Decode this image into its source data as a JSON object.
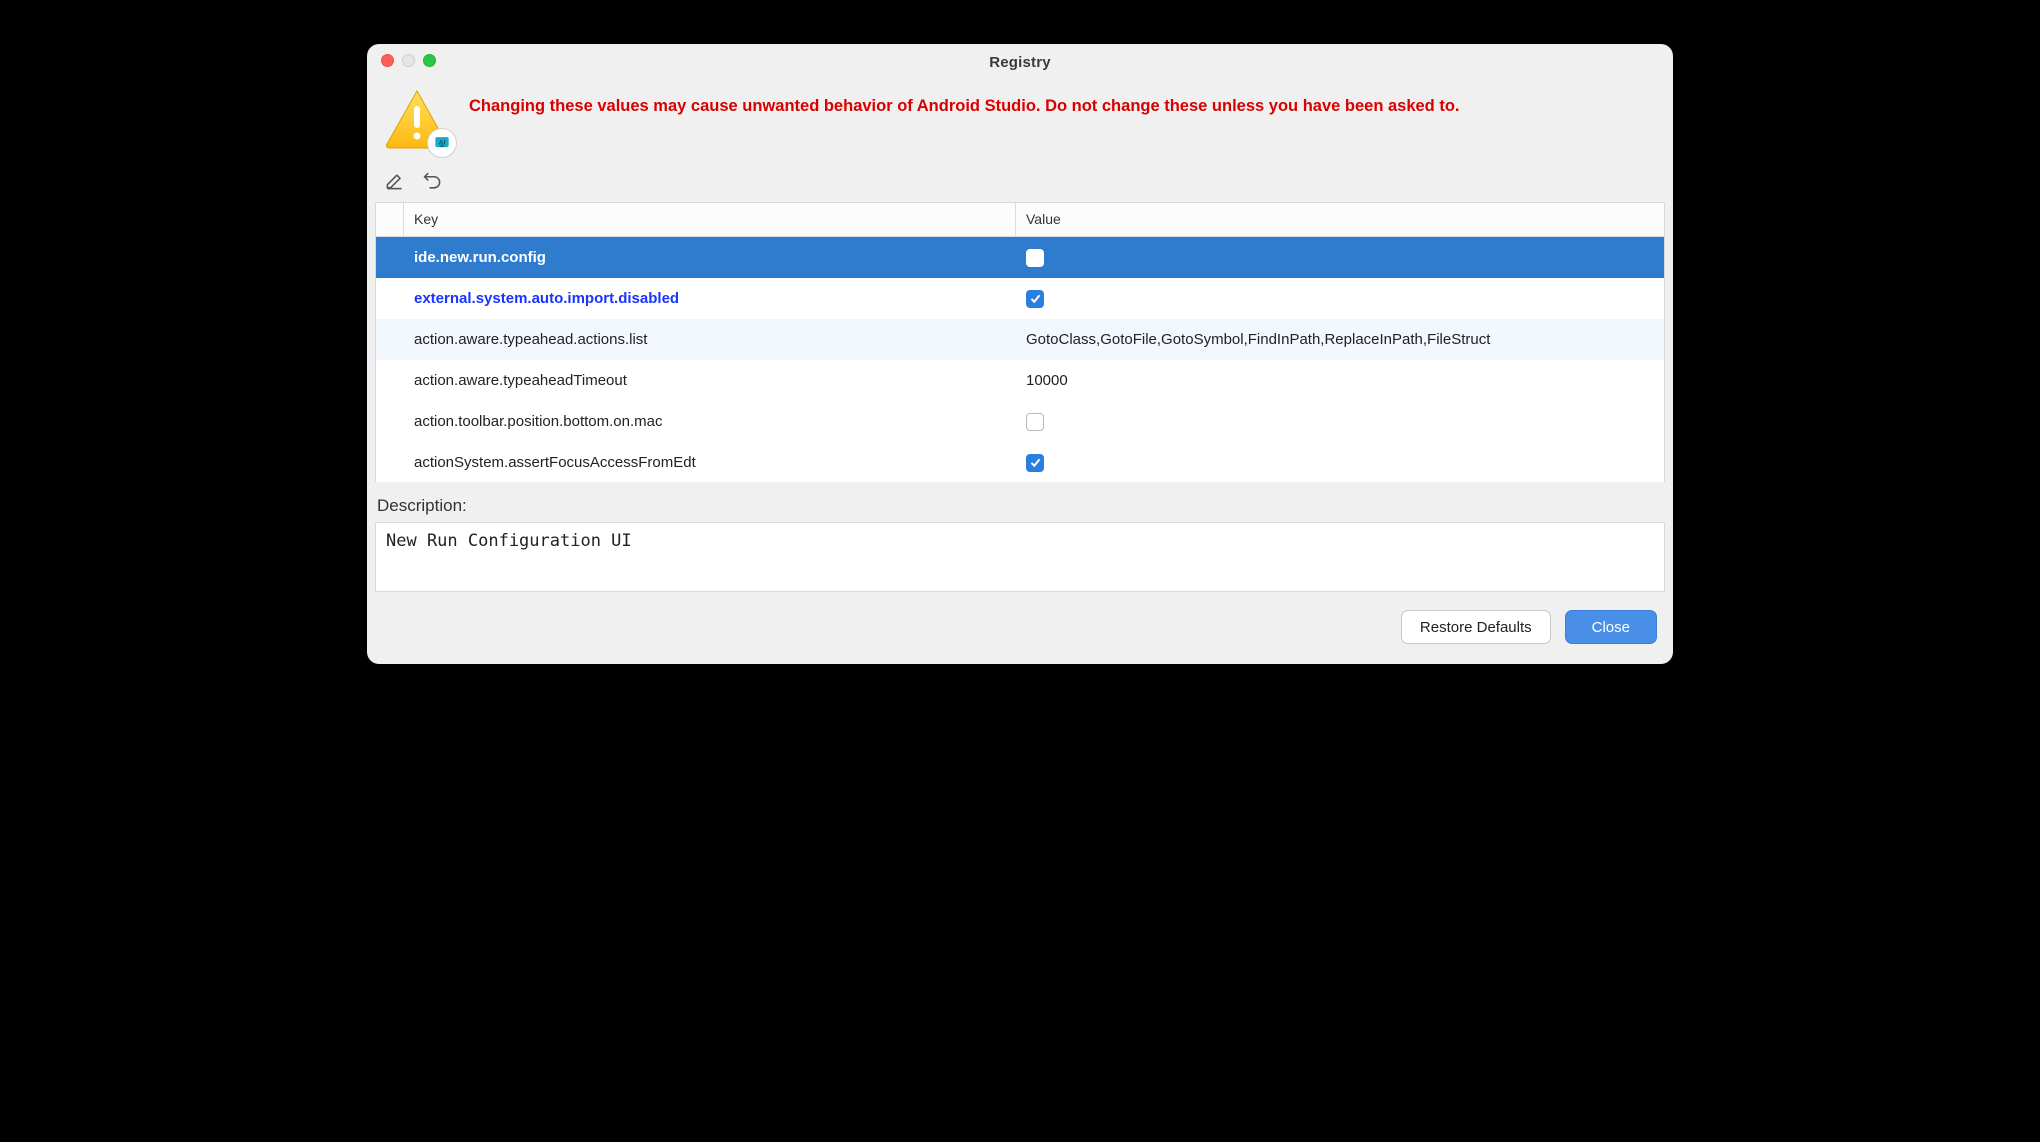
{
  "window": {
    "title": "Registry"
  },
  "warning": {
    "text": "Changing these values may cause unwanted behavior of Android Studio. Do not change these unless you have been asked to."
  },
  "toolbar": {
    "edit": "Edit",
    "revert": "Revert"
  },
  "table": {
    "headers": {
      "key": "Key",
      "value": "Value"
    },
    "rows": [
      {
        "key": "ide.new.run.config",
        "type": "checkbox",
        "checked": false,
        "selected": true,
        "modified": false
      },
      {
        "key": "external.system.auto.import.disabled",
        "type": "checkbox",
        "checked": true,
        "selected": false,
        "modified": true
      },
      {
        "key": "action.aware.typeahead.actions.list",
        "type": "text",
        "value": "GotoClass,GotoFile,GotoSymbol,FindInPath,ReplaceInPath,FileStruct",
        "selected": false,
        "modified": false,
        "alt": true
      },
      {
        "key": "action.aware.typeaheadTimeout",
        "type": "text",
        "value": "10000",
        "selected": false,
        "modified": false
      },
      {
        "key": "action.toolbar.position.bottom.on.mac",
        "type": "checkbox",
        "checked": false,
        "selected": false,
        "modified": false
      },
      {
        "key": "actionSystem.assertFocusAccessFromEdt",
        "type": "checkbox",
        "checked": true,
        "selected": false,
        "modified": false
      }
    ]
  },
  "description": {
    "label": "Description:",
    "text": "New Run Configuration UI"
  },
  "buttons": {
    "restore": "Restore Defaults",
    "close": "Close"
  }
}
